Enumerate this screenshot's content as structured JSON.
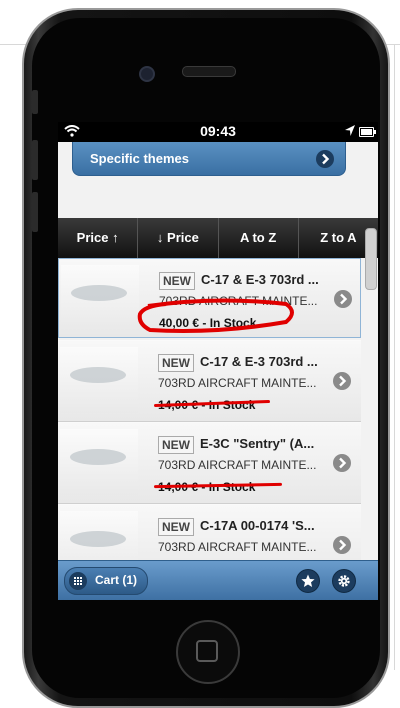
{
  "status": {
    "time": "09:43"
  },
  "themes": {
    "label": "Specific themes"
  },
  "sort": [
    {
      "label": "Price ↑"
    },
    {
      "label": "↓ Price"
    },
    {
      "label": "A to Z"
    },
    {
      "label": "Z to A"
    }
  ],
  "items": [
    {
      "badge": "NEW",
      "title": "C-17 & E-3 703rd ...",
      "subtitle": "703RD AIRCRAFT MAINTE...",
      "price": "40,00 € - In Stock"
    },
    {
      "badge": "NEW",
      "title": "C-17 & E-3 703rd ...",
      "subtitle": "703RD AIRCRAFT MAINTE...",
      "price": "14,00 € - In Stock"
    },
    {
      "badge": "NEW",
      "title": "E-3C \"Sentry\" (A...",
      "subtitle": "703RD AIRCRAFT MAINTE...",
      "price": "14,00 € - In Stock"
    },
    {
      "badge": "NEW",
      "title": "C-17A 00-0174 'S...",
      "subtitle": "703RD AIRCRAFT MAINTE...",
      "price": ""
    }
  ],
  "footer": {
    "cart_label": "Cart (1)"
  },
  "colors": {
    "accent": "#3a6fa3",
    "annotation": "#e00000"
  }
}
